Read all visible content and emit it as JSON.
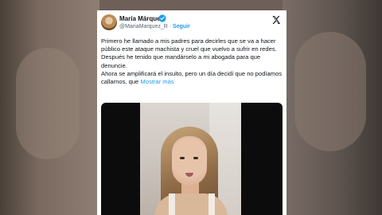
{
  "tweet": {
    "author_name": "María Márquez",
    "handle": "@MariaMarquez_R",
    "separator": "·",
    "follow_label": "Seguir",
    "text_line_1": "Primero he llamado a mis padres para decirles que se va a hacer público este ataque machista y cruel que vuelvo a sufrir en redes. Después he tenido que mandárselo a mi abogada para que denuncie.",
    "text_line_2": "Ahora se amplificará el insulto, pero un día decidí que no podíamos callarnos, que",
    "show_more": "Mostrar más"
  },
  "colors": {
    "accent": "#1d9bf0",
    "text": "#0f1419",
    "secondary": "#536471"
  },
  "icons": {
    "verified": "verified-badge-icon",
    "platform": "x-logo-icon"
  }
}
